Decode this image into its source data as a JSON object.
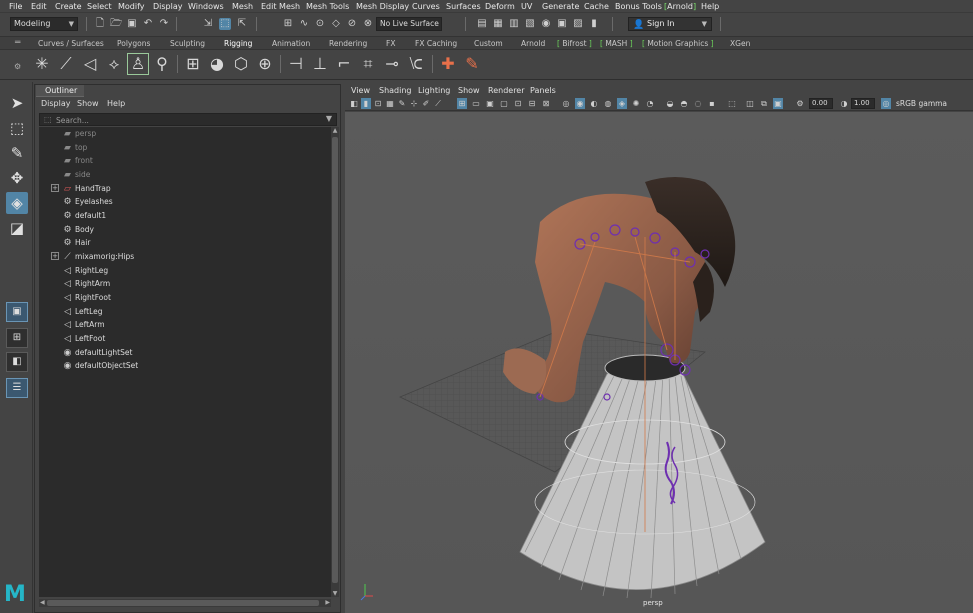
{
  "menubar": [
    "File",
    "Edit",
    "Create",
    "Select",
    "Modify",
    "Display",
    "Windows",
    "Mesh",
    "Edit Mesh",
    "Mesh Tools",
    "Mesh Display",
    "Curves",
    "Surfaces",
    "Deform",
    "UV",
    "Generate",
    "Cache",
    "Bonus Tools",
    "Arnold",
    "Help"
  ],
  "status_line": {
    "mode": "Modeling",
    "live_surface": "No Live Surface",
    "sign_in": "Sign In"
  },
  "shelf_tabs": [
    "Curves / Surfaces",
    "Polygons",
    "Sculpting",
    "Rigging",
    "Animation",
    "Rendering",
    "FX",
    "FX Caching",
    "Custom",
    "Arnold",
    "Bifrost",
    "MASH",
    "Motion Graphics",
    "XGen"
  ],
  "active_shelf_tab": "Rigging",
  "outliner": {
    "tab": "Outliner",
    "menu": [
      "Display",
      "Show",
      "Help"
    ],
    "search_placeholder": "Search...",
    "items": [
      {
        "label": "persp",
        "icon": "camera-icon",
        "dim": true
      },
      {
        "label": "top",
        "icon": "camera-icon",
        "dim": true
      },
      {
        "label": "front",
        "icon": "camera-icon",
        "dim": true
      },
      {
        "label": "side",
        "icon": "camera-icon",
        "dim": true
      },
      {
        "label": "HandTrap",
        "icon": "set-icon",
        "expandable": true
      },
      {
        "label": "Eyelashes",
        "icon": "mesh-icon"
      },
      {
        "label": "default1",
        "icon": "mesh-icon"
      },
      {
        "label": "Body",
        "icon": "mesh-icon"
      },
      {
        "label": "Hair",
        "icon": "mesh-icon"
      },
      {
        "label": "mixamorig:Hips",
        "icon": "joint-icon",
        "expandable": true
      },
      {
        "label": "RightLeg",
        "icon": "ik-icon"
      },
      {
        "label": "RightArm",
        "icon": "ik-icon"
      },
      {
        "label": "RightFoot",
        "icon": "ik-icon"
      },
      {
        "label": "LeftLeg",
        "icon": "ik-icon"
      },
      {
        "label": "LeftArm",
        "icon": "ik-icon"
      },
      {
        "label": "LeftFoot",
        "icon": "ik-icon"
      },
      {
        "label": "defaultLightSet",
        "icon": "set-icon"
      },
      {
        "label": "defaultObjectSet",
        "icon": "set-icon"
      }
    ]
  },
  "viewport": {
    "menu": [
      "View",
      "Shading",
      "Lighting",
      "Show",
      "Renderer",
      "Panels"
    ],
    "exposure": "0.00",
    "gamma": "1.00",
    "color_space": "sRGB gamma",
    "camera": "persp"
  },
  "colors": {
    "accent": "#5285a6",
    "arnold_green": "#7be36b",
    "viewport_bg": "#5a5a5a"
  }
}
